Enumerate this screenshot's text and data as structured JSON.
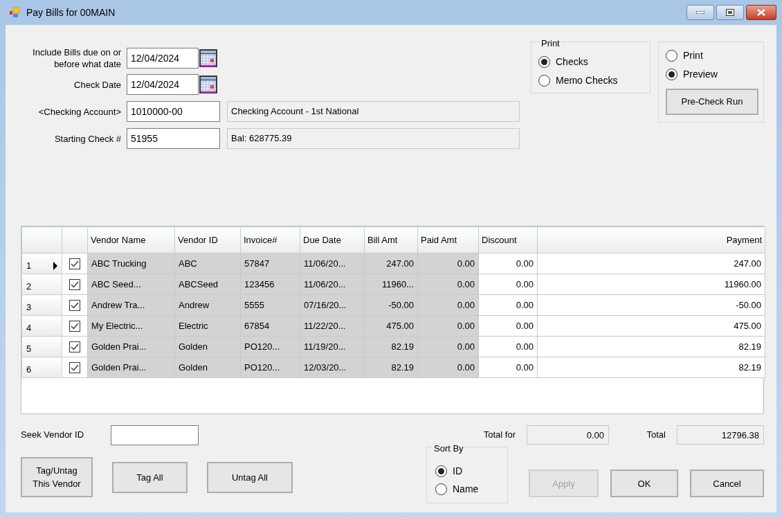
{
  "window": {
    "title": "Pay Bills for 00MAIN"
  },
  "fields": [
    {
      "label": "Include Bills due on or before what date",
      "value": "12/04/2024",
      "kind": "date"
    },
    {
      "label": "Check Date",
      "value": "12/04/2024",
      "kind": "date"
    },
    {
      "label": "<Checking Account>",
      "value": "1010000-00",
      "kind": "lookup",
      "info": "Checking Account - 1st National"
    },
    {
      "label": "Starting Check #",
      "value": "51955",
      "kind": "lookup",
      "info": "Bal: 628775.39"
    }
  ],
  "print_group": {
    "title": "Print",
    "options": [
      {
        "label": "Checks",
        "selected": true
      },
      {
        "label": "Memo Checks",
        "selected": false
      }
    ]
  },
  "output_group": {
    "options": [
      {
        "label": "Print",
        "selected": false
      },
      {
        "label": "Preview",
        "selected": true
      }
    ],
    "button": "Pre-Check Run"
  },
  "table": {
    "columns": [
      "Vendor Name",
      "Vendor ID",
      "Invoice#",
      "Due Date",
      "Bill Amt",
      "Paid Amt",
      "Discount",
      "Payment"
    ],
    "rows": [
      {
        "number": "1",
        "selected": true,
        "checked": true,
        "cells": [
          "ABC Trucking",
          "ABC",
          "57847",
          "11/06/20...",
          "247.00",
          "0.00",
          "0.00",
          "247.00"
        ]
      },
      {
        "number": "2",
        "selected": false,
        "checked": true,
        "cells": [
          "ABC Seed...",
          "ABCSeed",
          "123456",
          "11/06/20...",
          "11960...",
          "0.00",
          "0.00",
          "11960.00"
        ]
      },
      {
        "number": "3",
        "selected": false,
        "checked": true,
        "cells": [
          "Andrew Tra...",
          "Andrew",
          "5555",
          "07/16/20...",
          "-50.00",
          "0.00",
          "0.00",
          "-50.00"
        ]
      },
      {
        "number": "4",
        "selected": false,
        "checked": true,
        "cells": [
          "My Electric...",
          "Electric",
          "67854",
          "11/22/20...",
          "475.00",
          "0.00",
          "0.00",
          "475.00"
        ]
      },
      {
        "number": "5",
        "selected": false,
        "checked": true,
        "cells": [
          "Golden Prai...",
          "Golden",
          "PO120...",
          "11/19/20...",
          "82.19",
          "0.00",
          "0.00",
          "82.19"
        ]
      },
      {
        "number": "6",
        "selected": false,
        "checked": true,
        "cells": [
          "Golden Prai...",
          "Golden",
          "PO120...",
          "12/03/20...",
          "82.19",
          "0.00",
          "0.00",
          "82.19"
        ]
      }
    ]
  },
  "seek": {
    "label": "Seek Vendor ID"
  },
  "totals": [
    {
      "label": "Total for",
      "value": "0.00"
    },
    {
      "label": "Total",
      "value": "12796.38"
    }
  ],
  "sort_by": {
    "title": "Sort By",
    "options": [
      {
        "label": "ID",
        "selected": true
      },
      {
        "label": "Name",
        "selected": false
      }
    ]
  },
  "buttons": [
    {
      "label": "Tag/Untag This Vendor",
      "disabled": false
    },
    {
      "label": "Tag All",
      "disabled": false
    },
    {
      "label": "Untag All",
      "disabled": false
    }
  ],
  "dialog_buttons": [
    {
      "label": "Apply",
      "disabled": true
    },
    {
      "label": "OK",
      "disabled": false
    },
    {
      "label": "Cancel",
      "disabled": false
    }
  ]
}
